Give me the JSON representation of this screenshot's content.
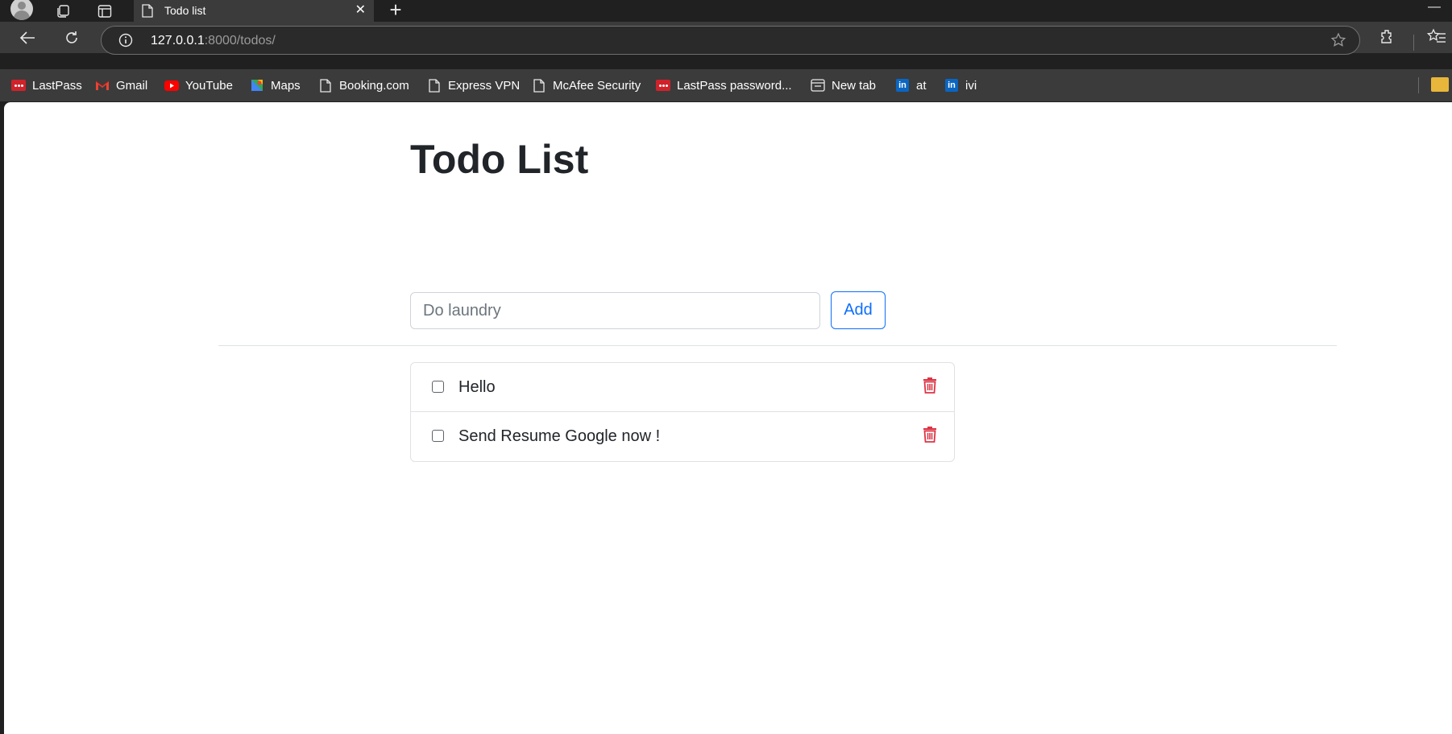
{
  "browser": {
    "tab_title": "Todo list",
    "url_host": "127.0.0.1",
    "url_path": ":8000/todos/",
    "bookmarks": [
      {
        "label": "LastPass",
        "icon": "lastpass-icon"
      },
      {
        "label": "Gmail",
        "icon": "gmail-icon"
      },
      {
        "label": "YouTube",
        "icon": "youtube-icon"
      },
      {
        "label": "Maps",
        "icon": "maps-icon"
      },
      {
        "label": "Booking.com",
        "icon": "page-icon"
      },
      {
        "label": "Express VPN",
        "icon": "page-icon"
      },
      {
        "label": "McAfee Security",
        "icon": "page-icon"
      },
      {
        "label": "LastPass password...",
        "icon": "lastpass-icon"
      },
      {
        "label": "New tab",
        "icon": "new-tab-icon"
      },
      {
        "label": "at",
        "icon": "linkedin-icon"
      },
      {
        "label": "ivi",
        "icon": "linkedin-icon"
      }
    ]
  },
  "page": {
    "title": "Todo List",
    "input_placeholder": "Do laundry",
    "add_label": "Add",
    "todos": [
      {
        "text": "Hello",
        "done": false
      },
      {
        "text": "Send Resume Google now !",
        "done": false
      }
    ]
  },
  "colors": {
    "primary": "#0d6efd",
    "danger": "#dc3545",
    "chrome_dark": "#202020",
    "chrome_toolbar": "#3b3b3b"
  }
}
